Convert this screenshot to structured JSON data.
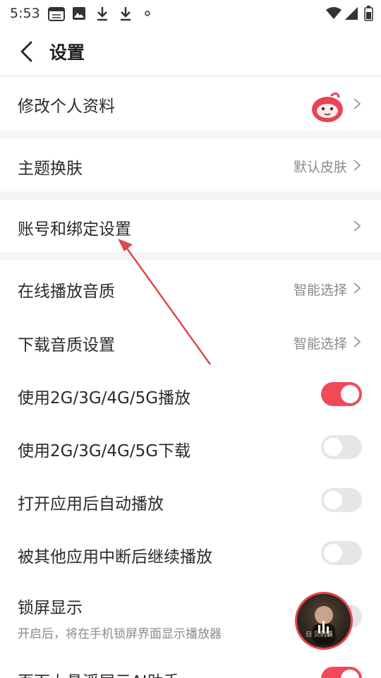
{
  "status_bar": {
    "time": "5:53",
    "icons": [
      "calendar-icon",
      "image-icon",
      "download-icon",
      "download-icon",
      "dot-icon",
      "wifi-icon",
      "signal-icon",
      "battery-icon"
    ]
  },
  "header": {
    "title": "设置",
    "back_icon": "chevron-left-icon"
  },
  "settings": {
    "edit_profile": {
      "label": "修改个人资料"
    },
    "theme": {
      "label": "主题换肤",
      "value": "默认皮肤"
    },
    "account_binding": {
      "label": "账号和绑定设置"
    },
    "online_quality": {
      "label": "在线播放音质",
      "value": "智能选择"
    },
    "download_quality": {
      "label": "下载音质设置",
      "value": "智能选择"
    },
    "mobile_play": {
      "label": "使用2G/3G/4G/5G播放",
      "on": true
    },
    "mobile_download": {
      "label": "使用2G/3G/4G/5G下载",
      "on": false
    },
    "autoplay_on_open": {
      "label": "打开应用后自动播放",
      "on": false
    },
    "resume_after_interrupt": {
      "label": "被其他应用中断后继续播放",
      "on": false
    },
    "lock_screen": {
      "label": "锁屏显示",
      "description": "开启后，将在手机锁屏界面显示播放器",
      "on": false
    },
    "floating_ai": {
      "label": "页面上悬浮展示AI助手",
      "on": true
    }
  },
  "mini_player": {
    "caption": "日 贝的霸"
  },
  "colors": {
    "accent": "#f2495a",
    "toggle_off": "#e6e6e6",
    "annotation_arrow": "#e04848",
    "separator": "#f5f5f5"
  }
}
